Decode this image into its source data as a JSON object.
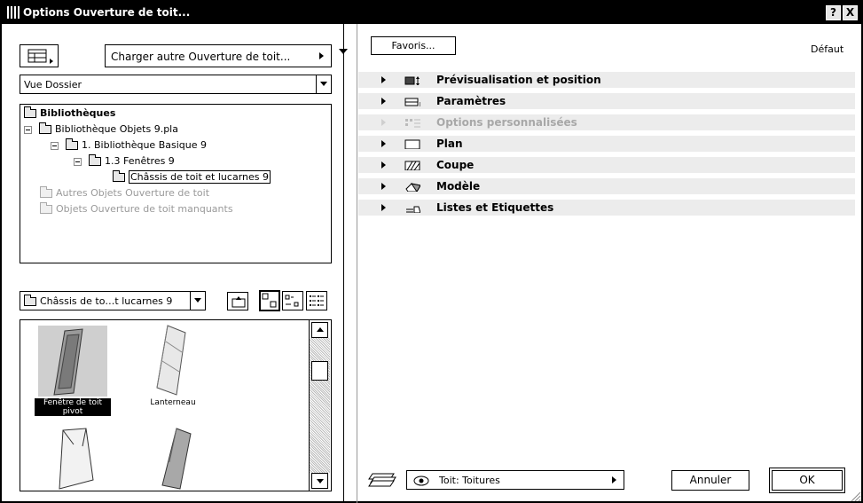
{
  "window": {
    "title": "Options Ouverture de toit...",
    "help_label": "?",
    "close_label": "X"
  },
  "left": {
    "load_other_label": "Charger autre Ouverture de toit...",
    "view_mode": "Vue Dossier",
    "tree": [
      {
        "label": "Bibliothèques"
      },
      {
        "label": "Bibliothèque Objets 9.pla"
      },
      {
        "label": "1. Bibliothèque Basique 9"
      },
      {
        "label": "1.3 Fenêtres 9"
      },
      {
        "label": "Châssis de toit et lucarnes 9"
      },
      {
        "label": "Autres Objets Ouverture de toit"
      },
      {
        "label": "Objets Ouverture de toit manquants"
      }
    ],
    "folder_select": "Châssis de to…t lucarnes 9",
    "objects": [
      {
        "label": "Fenêtre de toit pivot",
        "selected": true
      },
      {
        "label": "Lanterneau",
        "selected": false
      },
      {
        "label": "",
        "selected": false
      },
      {
        "label": "",
        "selected": false
      }
    ]
  },
  "right": {
    "favorites_label": "Favoris...",
    "default_label": "Défaut",
    "sections": [
      {
        "label": "Prévisualisation et position",
        "enabled": true
      },
      {
        "label": "Paramètres",
        "enabled": true
      },
      {
        "label": "Options personnalisées",
        "enabled": false
      },
      {
        "label": "Plan",
        "enabled": true
      },
      {
        "label": "Coupe",
        "enabled": true
      },
      {
        "label": "Modèle",
        "enabled": true
      },
      {
        "label": "Listes et Etiquettes",
        "enabled": true
      }
    ],
    "layer_label": "Toit: Toitures",
    "cancel_label": "Annuler",
    "ok_label": "OK"
  }
}
